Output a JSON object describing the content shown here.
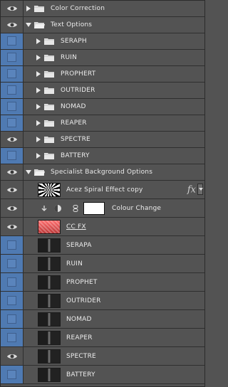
{
  "layers": [
    {
      "type": "group",
      "level": 0,
      "expanded": false,
      "visible": true,
      "label": "Color Correction"
    },
    {
      "type": "group",
      "level": 0,
      "expanded": true,
      "visible": true,
      "label": "Text Options"
    },
    {
      "type": "group",
      "level": 1,
      "expanded": false,
      "visible": false,
      "label": "SERAPH"
    },
    {
      "type": "group",
      "level": 1,
      "expanded": false,
      "visible": false,
      "label": "RUIN"
    },
    {
      "type": "group",
      "level": 1,
      "expanded": false,
      "visible": false,
      "label": "PROPHERT"
    },
    {
      "type": "group",
      "level": 1,
      "expanded": false,
      "visible": false,
      "label": "OUTRIDER"
    },
    {
      "type": "group",
      "level": 1,
      "expanded": false,
      "visible": false,
      "label": "NOMAD"
    },
    {
      "type": "group",
      "level": 1,
      "expanded": false,
      "visible": false,
      "label": "REAPER"
    },
    {
      "type": "group",
      "level": 1,
      "expanded": false,
      "visible": true,
      "label": "SPECTRE"
    },
    {
      "type": "group",
      "level": 1,
      "expanded": false,
      "visible": false,
      "label": "BATTERY"
    },
    {
      "type": "group",
      "level": 0,
      "expanded": true,
      "visible": true,
      "label": "Specialist Background Options"
    },
    {
      "type": "layer",
      "level": 1,
      "visible": true,
      "label": "Acez Spiral Effect copy",
      "thumb": "spiral",
      "fx": "fx"
    },
    {
      "type": "adjust",
      "level": 1,
      "visible": true,
      "label": "Colour Change"
    },
    {
      "type": "layer",
      "level": 1,
      "visible": true,
      "label": "CC FX",
      "thumb": "red",
      "underline": true
    },
    {
      "type": "layer",
      "level": 1,
      "visible": false,
      "label": "SERAPA",
      "thumb": "dark"
    },
    {
      "type": "layer",
      "level": 1,
      "visible": false,
      "label": "RUIN",
      "thumb": "dark"
    },
    {
      "type": "layer",
      "level": 1,
      "visible": false,
      "label": "PROPHET",
      "thumb": "dark"
    },
    {
      "type": "layer",
      "level": 1,
      "visible": false,
      "label": "OUTRIDER",
      "thumb": "dark"
    },
    {
      "type": "layer",
      "level": 1,
      "visible": false,
      "label": "NOMAD",
      "thumb": "dark"
    },
    {
      "type": "layer",
      "level": 1,
      "visible": false,
      "label": "REAPER",
      "thumb": "dark"
    },
    {
      "type": "layer",
      "level": 1,
      "visible": true,
      "label": "SPECTRE",
      "thumb": "dark"
    },
    {
      "type": "layer",
      "level": 1,
      "visible": false,
      "label": "BATTERY",
      "thumb": "dark"
    }
  ]
}
